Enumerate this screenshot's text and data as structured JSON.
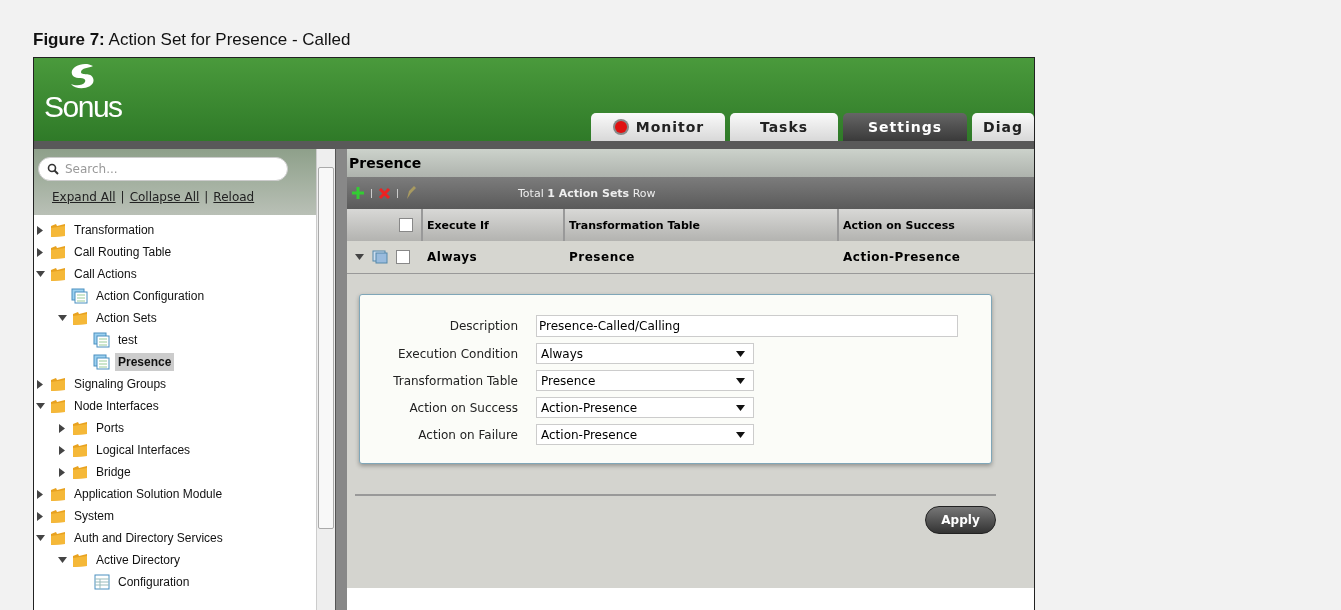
{
  "caption": {
    "label": "Figure 7:",
    "text": "Action Set for Presence - Called"
  },
  "header": {
    "logo": "Sonus",
    "tabs": [
      {
        "label": "Monitor",
        "selected": false,
        "kind": "alert"
      },
      {
        "label": "Tasks",
        "selected": false,
        "kind": "plain"
      },
      {
        "label": "Settings",
        "selected": true,
        "kind": "plain"
      },
      {
        "label": "Diag",
        "selected": false,
        "kind": "plain"
      }
    ]
  },
  "sidebar": {
    "search": {
      "placeholder": "Search..."
    },
    "links": [
      "Expand All",
      "Collapse All",
      "Reload"
    ],
    "link_separator": "|",
    "tree": [
      {
        "label": "Transformation",
        "kind": "folder",
        "expanded": false,
        "selected": false
      },
      {
        "label": "Call Routing Table",
        "kind": "folder",
        "expanded": false,
        "selected": false
      },
      {
        "label": "Call Actions",
        "kind": "folder",
        "expanded": true,
        "selected": false,
        "children": [
          {
            "label": "Action Configuration",
            "kind": "set",
            "selected": false
          },
          {
            "label": "Action Sets",
            "kind": "folder",
            "expanded": true,
            "selected": false,
            "children": [
              {
                "label": "test",
                "kind": "set",
                "selected": false
              },
              {
                "label": "Presence",
                "kind": "set",
                "selected": true
              }
            ]
          }
        ]
      },
      {
        "label": "Signaling Groups",
        "kind": "folder",
        "expanded": false,
        "selected": false
      },
      {
        "label": "Node Interfaces",
        "kind": "folder",
        "expanded": true,
        "selected": false,
        "children": [
          {
            "label": "Ports",
            "kind": "folder",
            "expanded": false,
            "selected": false
          },
          {
            "label": "Logical Interfaces",
            "kind": "folder",
            "expanded": false,
            "selected": false
          },
          {
            "label": "Bridge",
            "kind": "folder",
            "expanded": false,
            "selected": false
          }
        ]
      },
      {
        "label": "Application Solution Module",
        "kind": "folder",
        "expanded": false,
        "selected": false
      },
      {
        "label": "System",
        "kind": "folder",
        "expanded": false,
        "selected": false
      },
      {
        "label": "Auth and Directory Services",
        "kind": "folder",
        "expanded": true,
        "selected": false,
        "children": [
          {
            "label": "Active Directory",
            "kind": "folder",
            "expanded": true,
            "selected": false,
            "children": [
              {
                "label": "Configuration",
                "kind": "table",
                "selected": false
              }
            ]
          }
        ]
      }
    ]
  },
  "panel": {
    "title": "Presence",
    "toolbar": {
      "total_prefix": "Total",
      "total_count": "1 Action Sets",
      "total_suffix": "Row"
    },
    "table": {
      "select_all": {
        "checked": false
      },
      "columns": [
        "Execute If",
        "Transformation Table",
        "Action on Success"
      ],
      "rows": [
        {
          "expanded": true,
          "checked": false,
          "cells": [
            "Always",
            "Presence",
            "Action-Presence"
          ]
        }
      ]
    },
    "form": {
      "fields": [
        {
          "label": "Description",
          "kind": "text",
          "value": "Presence-Called/Calling"
        },
        {
          "label": "Execution Condition",
          "kind": "select",
          "value": "Always"
        },
        {
          "label": "Transformation Table",
          "kind": "select",
          "value": "Presence"
        },
        {
          "label": "Action on Success",
          "kind": "select",
          "value": "Action-Presence"
        },
        {
          "label": "Action on Failure",
          "kind": "select",
          "value": "Action-Presence"
        }
      ]
    },
    "apply": "Apply"
  }
}
